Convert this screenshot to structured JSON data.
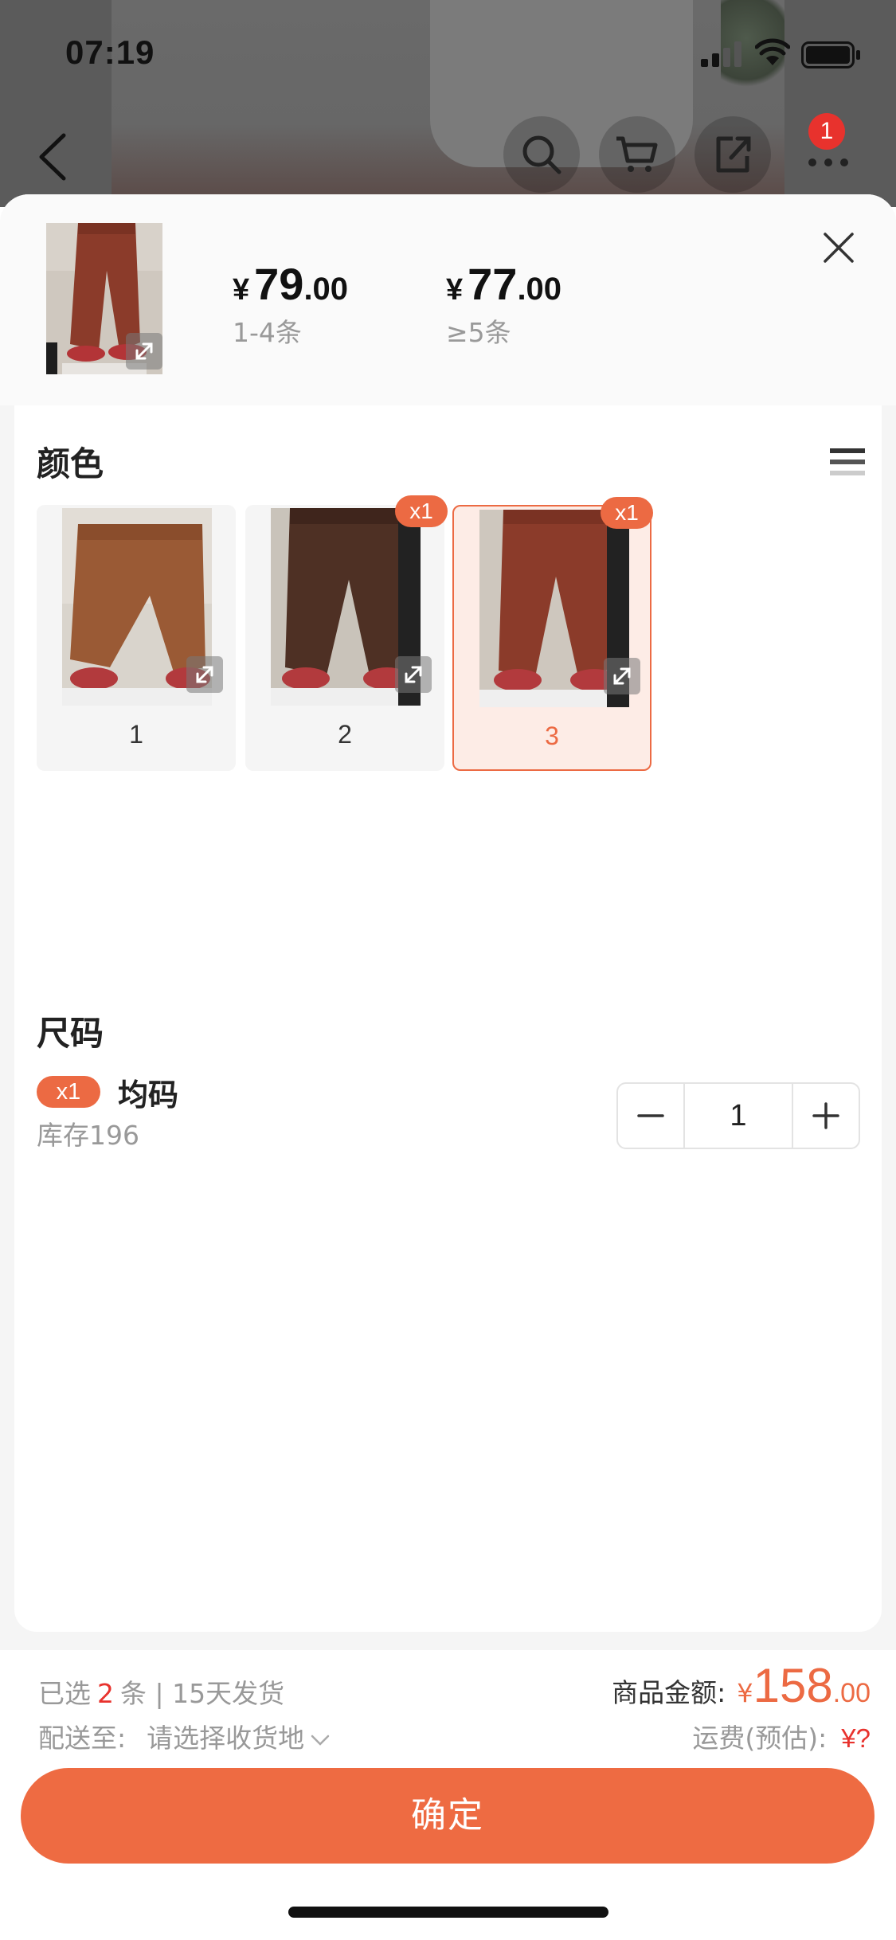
{
  "status_bar": {
    "time": "07:19"
  },
  "nav": {
    "cart_badge": "1"
  },
  "header": {
    "prices": [
      {
        "currency": "¥",
        "integer": "79",
        "decimal": ".00",
        "range": "1-4条"
      },
      {
        "currency": "¥",
        "integer": "77",
        "decimal": ".00",
        "range": "≥5条"
      }
    ]
  },
  "colors": {
    "title": "颜色",
    "items": [
      {
        "label": "1",
        "count": "",
        "selected": false
      },
      {
        "label": "2",
        "count": "x1",
        "selected": false
      },
      {
        "label": "3",
        "count": "x1",
        "selected": true
      }
    ]
  },
  "size": {
    "title": "尺码",
    "badge": "x1",
    "name": "均码",
    "stock": "库存196",
    "minus": "−",
    "quantity": "1",
    "plus": "+"
  },
  "footer": {
    "selected_prefix": "已选",
    "selected_count": "2",
    "selected_suffix": "条 | 15天发货",
    "ship_label": "配送至:",
    "ship_placeholder": "请选择收货地",
    "amount_label": "商品金额:",
    "amount_currency": "¥",
    "amount_integer": "158",
    "amount_decimal": ".00",
    "freight_label": "运费(预估):",
    "freight_value": "¥?",
    "confirm_label": "确定"
  },
  "theme": {
    "accent": "#ec6a43",
    "price_red": "#e8322d"
  },
  "icons": [
    "back-icon",
    "search-icon",
    "cart-icon",
    "share-icon",
    "more-icon",
    "close-icon",
    "list-icon",
    "expand-icon",
    "chevron-down-icon"
  ]
}
